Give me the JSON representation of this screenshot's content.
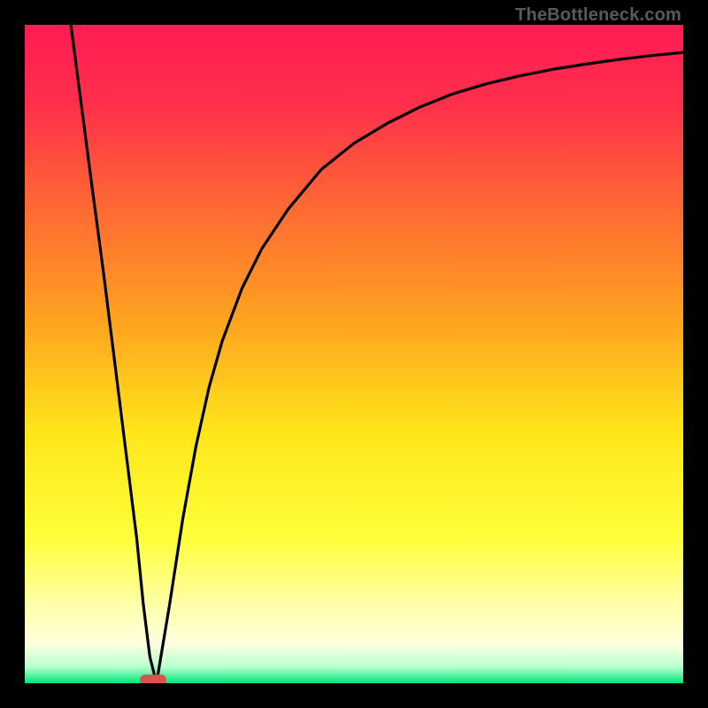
{
  "watermark": "TheBottleneck.com",
  "chart_data": {
    "type": "line",
    "title": "",
    "xlabel": "",
    "ylabel": "",
    "xlim": [
      0,
      100
    ],
    "ylim": [
      0,
      100
    ],
    "grid": false,
    "series": [
      {
        "name": "curve",
        "x": [
          7,
          10,
          12,
          14,
          15,
          16,
          17,
          18,
          19,
          20,
          22,
          24,
          26,
          28,
          30,
          33,
          36,
          40,
          45,
          50,
          55,
          60,
          65,
          70,
          75,
          80,
          85,
          90,
          95,
          100
        ],
        "y": [
          100,
          77,
          62,
          46,
          38,
          30,
          22,
          12,
          4,
          0,
          12,
          25,
          36,
          45,
          52,
          60,
          66,
          72,
          78,
          82,
          85,
          87.5,
          89.5,
          91,
          92.2,
          93.2,
          94,
          94.7,
          95.3,
          95.8
        ]
      }
    ],
    "marker": {
      "x": 19.5,
      "y": 0.5,
      "color": "#d9534f"
    },
    "background_gradient": {
      "stops": [
        {
          "pos": 0.0,
          "color": "#ff1c55"
        },
        {
          "pos": 0.12,
          "color": "#ff2f4b"
        },
        {
          "pos": 0.28,
          "color": "#ff6a33"
        },
        {
          "pos": 0.45,
          "color": "#ffa31f"
        },
        {
          "pos": 0.62,
          "color": "#ffe61a"
        },
        {
          "pos": 0.78,
          "color": "#ffff3a"
        },
        {
          "pos": 0.88,
          "color": "#ffffa8"
        },
        {
          "pos": 0.94,
          "color": "#ffffe0"
        },
        {
          "pos": 0.975,
          "color": "#b8ffd0"
        },
        {
          "pos": 1.0,
          "color": "#00e67a"
        }
      ]
    }
  }
}
